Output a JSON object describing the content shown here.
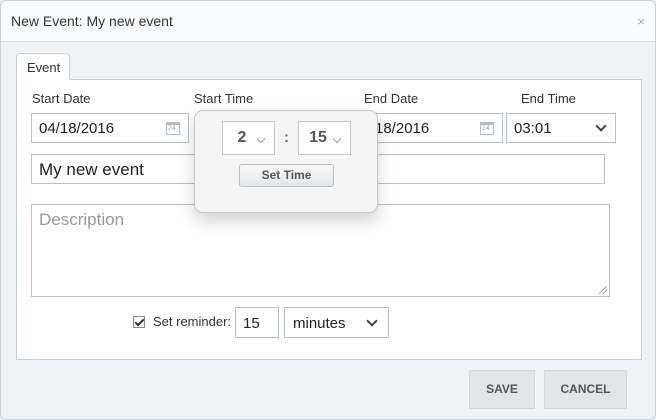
{
  "dialog": {
    "title": "New Event: My new event",
    "close_glyph": "×"
  },
  "tab": {
    "label": "Event"
  },
  "fields": {
    "start_date_label": "Start Date",
    "start_date_value": "04/18/2016",
    "start_time_label": "Start Time",
    "end_date_label": "End Date",
    "end_date_value": "18/2016",
    "end_time_label": "End Time",
    "end_time_value": "03:01",
    "title_value": "My new event",
    "description_placeholder": "Description"
  },
  "time_picker": {
    "hour": "2",
    "separator": ":",
    "minute": "15",
    "set_time_label": "Set Time"
  },
  "reminder": {
    "checked": true,
    "label": "Set reminder:",
    "amount": "15",
    "unit": "minutes"
  },
  "buttons": {
    "save": "SAVE",
    "cancel": "CANCEL"
  },
  "icons": [
    "calendar-icon",
    "chevron-down-icon",
    "close-icon",
    "checkbox-check-icon",
    "resize-grip-icon"
  ]
}
